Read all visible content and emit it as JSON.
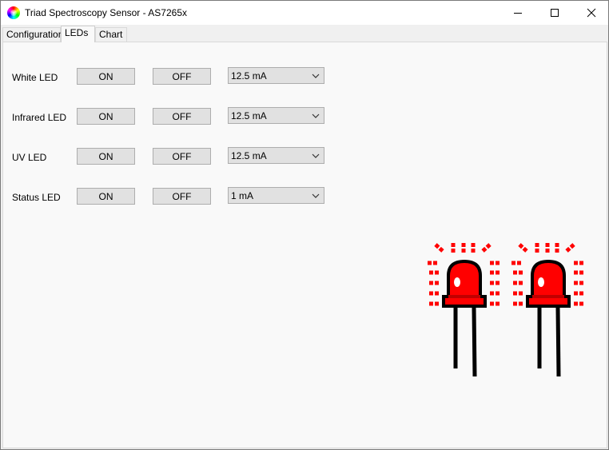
{
  "window": {
    "title": "Triad Spectroscopy Sensor - AS7265x"
  },
  "tabs": [
    {
      "label": "Configuration",
      "selected": false
    },
    {
      "label": "LEDs",
      "selected": true
    },
    {
      "label": "Chart",
      "selected": false
    }
  ],
  "leds": [
    {
      "label": "White LED",
      "on_label": "ON",
      "off_label": "OFF",
      "current": "12.5 mA"
    },
    {
      "label": "Infrared LED",
      "on_label": "ON",
      "off_label": "OFF",
      "current": "12.5 mA"
    },
    {
      "label": "UV LED",
      "on_label": "ON",
      "off_label": "OFF",
      "current": "12.5 mA"
    },
    {
      "label": "Status LED",
      "on_label": "ON",
      "off_label": "OFF",
      "current": "1 mA"
    }
  ],
  "icons": {
    "app": "color-wheel-icon",
    "minimize": "minimize-icon",
    "maximize": "maximize-icon",
    "close": "close-icon",
    "dropdown": "chevron-down-icon",
    "illustration": "glowing-led-icon"
  },
  "colors": {
    "led_red": "#ff0000",
    "led_dark_red": "#c00000"
  }
}
